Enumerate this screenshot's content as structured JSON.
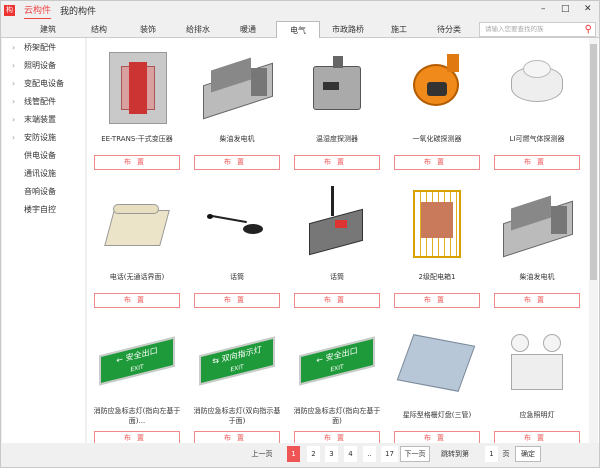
{
  "titlebar": {
    "logo": "构",
    "tabs": [
      "云构件",
      "我的构件"
    ],
    "active_tab": 0,
    "controls": [
      "–",
      "□",
      "✕"
    ]
  },
  "categories": {
    "tabs": [
      "建筑",
      "结构",
      "装饰",
      "给排水",
      "暖通",
      "电气",
      "市政路桥",
      "施工",
      "待分类"
    ],
    "active": "电气"
  },
  "search": {
    "placeholder": "请输入您要查找的族"
  },
  "sidebar": {
    "items": [
      {
        "label": "桥架配件",
        "expandable": true
      },
      {
        "label": "照明设备",
        "expandable": true
      },
      {
        "label": "变配电设备",
        "expandable": true
      },
      {
        "label": "线管配件",
        "expandable": true
      },
      {
        "label": "末端装置",
        "expandable": true
      },
      {
        "label": "安防设施",
        "expandable": true
      },
      {
        "label": "供电设备",
        "expandable": false
      },
      {
        "label": "通讯设施",
        "expandable": false
      },
      {
        "label": "音响设备",
        "expandable": false
      },
      {
        "label": "楼宇自控",
        "expandable": false
      }
    ]
  },
  "items": [
    {
      "name": "EE-TRANS-干式变压器",
      "icon": "transformer",
      "button": "布置"
    },
    {
      "name": "柴油发电机",
      "icon": "generator",
      "button": "布置"
    },
    {
      "name": "温湿度探测器",
      "icon": "humidity-detector",
      "button": "布置"
    },
    {
      "name": "一氧化碳探测器",
      "icon": "co-detector",
      "button": "布置"
    },
    {
      "name": "LI可燃气体探测器",
      "icon": "gas-detector",
      "button": "布置"
    },
    {
      "name": "电话(无通话界面)",
      "icon": "telephone",
      "button": "布置"
    },
    {
      "name": "话筒",
      "icon": "microphone",
      "button": "布置"
    },
    {
      "name": "话筒",
      "icon": "paging-console",
      "button": "布置"
    },
    {
      "name": "2级配电箱1",
      "icon": "distribution-box",
      "button": "布置"
    },
    {
      "name": "柴油发电机",
      "icon": "generator",
      "button": "布置"
    },
    {
      "name": "消防应急标志灯(指向左基于面)...",
      "icon": "exit-sign",
      "button": "布置"
    },
    {
      "name": "消防应急标志灯(双向指示基于面)",
      "icon": "exit-sign",
      "button": "布置"
    },
    {
      "name": "消防应急标志灯(指向左基于面)",
      "icon": "exit-sign",
      "button": "布置"
    },
    {
      "name": "星际型格栅灯盘(三管)",
      "icon": "grille-light",
      "button": "布置"
    },
    {
      "name": "应急照明灯",
      "icon": "emergency-light",
      "button": "布置"
    }
  ],
  "exit_sign_text": {
    "cn": "安全出口",
    "en": "EXIT",
    "cn2": "双向指示灯"
  },
  "pagination": {
    "prev": "上一页",
    "pages": [
      "1",
      "2",
      "3",
      "4",
      "..",
      "17"
    ],
    "current": "1",
    "next": "下一页",
    "jump_label": "跳转到第",
    "jump_value": "1",
    "page_unit": "页",
    "confirm": "确定"
  },
  "colors": {
    "accent": "#e44444",
    "button_border": "#f08a8a",
    "exit_green": "#1f9a3a"
  }
}
